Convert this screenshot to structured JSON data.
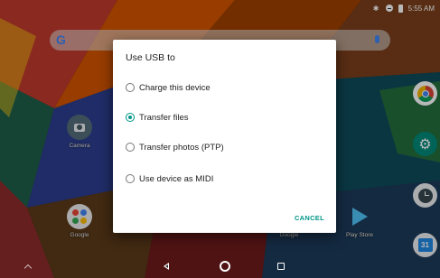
{
  "status_bar": {
    "time": "5:55 AM",
    "icons": [
      "bluetooth-icon",
      "do-not-disturb-icon",
      "battery-icon"
    ]
  },
  "search": {
    "logo": "G"
  },
  "home_apps": [
    {
      "label": "Camera",
      "icon": "camera-icon"
    },
    {
      "label": "Google",
      "icon": "google-folder-icon"
    },
    {
      "label": "Google",
      "icon": "google-icon"
    },
    {
      "label": "Play Store",
      "icon": "play-store-icon"
    }
  ],
  "side_icons": [
    "chrome-icon",
    "settings-icon",
    "clock-icon",
    "calendar-icon"
  ],
  "calendar_day": "31",
  "dialog": {
    "title": "Use USB to",
    "options": [
      {
        "label": "Charge this device",
        "selected": false
      },
      {
        "label": "Transfer files",
        "selected": true
      },
      {
        "label": "Transfer photos (PTP)",
        "selected": false
      },
      {
        "label": "Use device as MIDI",
        "selected": false
      }
    ],
    "cancel_label": "CANCEL"
  },
  "colors": {
    "accent": "#009688",
    "google_blue": "#4285f4"
  }
}
